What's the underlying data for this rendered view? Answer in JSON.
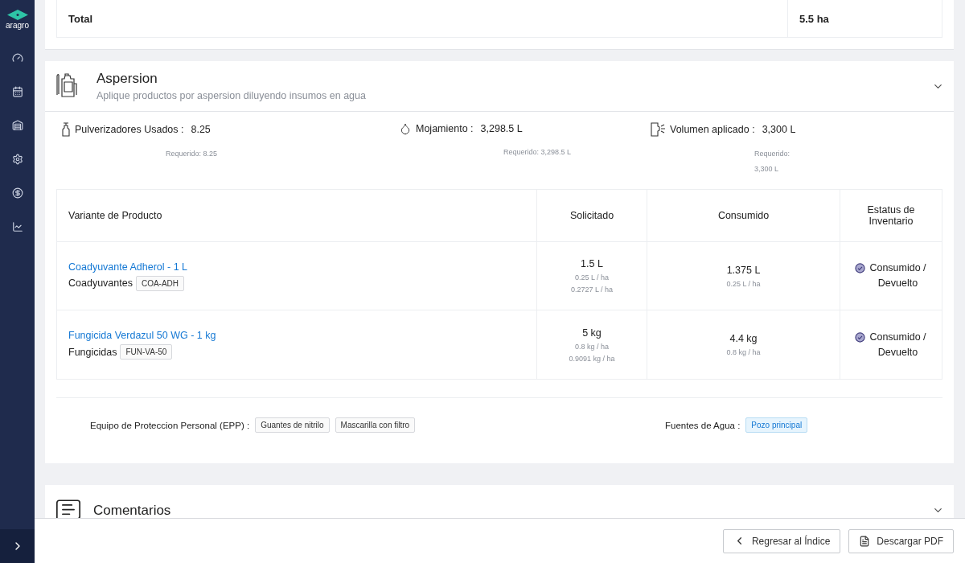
{
  "sidebar": {
    "logo": "aragro"
  },
  "summary": {
    "label": "Total",
    "value": "5.5 ha"
  },
  "aspersion": {
    "title": "Aspersion",
    "subtitle": "Aplique productos por aspersion diluyendo insumos en agua",
    "metrics": [
      {
        "kind": "bottle",
        "label": "Pulverizadores Usados :",
        "value": "8.25",
        "required": "Requerido: 8.25"
      },
      {
        "kind": "drop",
        "label": "Mojamiento :",
        "value": "3,298.5 L",
        "required": "Requerido: 3,298.5 L"
      },
      {
        "kind": "spray",
        "label": "Volumen aplicado :",
        "value": "3,300 L",
        "required": "Requerido: 3,300 L"
      }
    ],
    "table": {
      "columns": [
        "Variante de Producto",
        "Solicitado",
        "Consumido",
        "Estatus de Inventario"
      ],
      "rows": [
        {
          "product": "Coadyuvante Adherol - 1 L",
          "category": "Coadyuvantes",
          "code": "COA-ADH",
          "requested": "1.5 L",
          "requested_rates": [
            "0.25 L / ha",
            "0.2727 L / ha"
          ],
          "consumed": "1.375 L",
          "consumed_rate": "0.25 L / ha",
          "status": "Consumido / Devuelto"
        },
        {
          "product": "Fungicida Verdazul 50 WG - 1 kg",
          "category": "Fungicidas",
          "code": "FUN-VA-50",
          "requested": "5 kg",
          "requested_rates": [
            "0.8 kg / ha",
            "0.9091 kg / ha"
          ],
          "consumed": "4.4 kg",
          "consumed_rate": "0.8 kg / ha",
          "status": "Consumido / Devuelto"
        }
      ]
    },
    "epp": {
      "label": "Equipo de Proteccion Personal (EPP) :",
      "items": [
        "Guantes de nitrilo",
        "Mascarilla con filtro"
      ]
    },
    "water": {
      "label": "Fuentes de Agua :",
      "items": [
        "Pozo principal"
      ]
    }
  },
  "comments": {
    "title": "Comentarios"
  },
  "footer": {
    "buttons": [
      {
        "kind": "back",
        "label": "Regresar al Índice"
      },
      {
        "kind": "pdf",
        "label": "Descargar PDF"
      }
    ]
  }
}
